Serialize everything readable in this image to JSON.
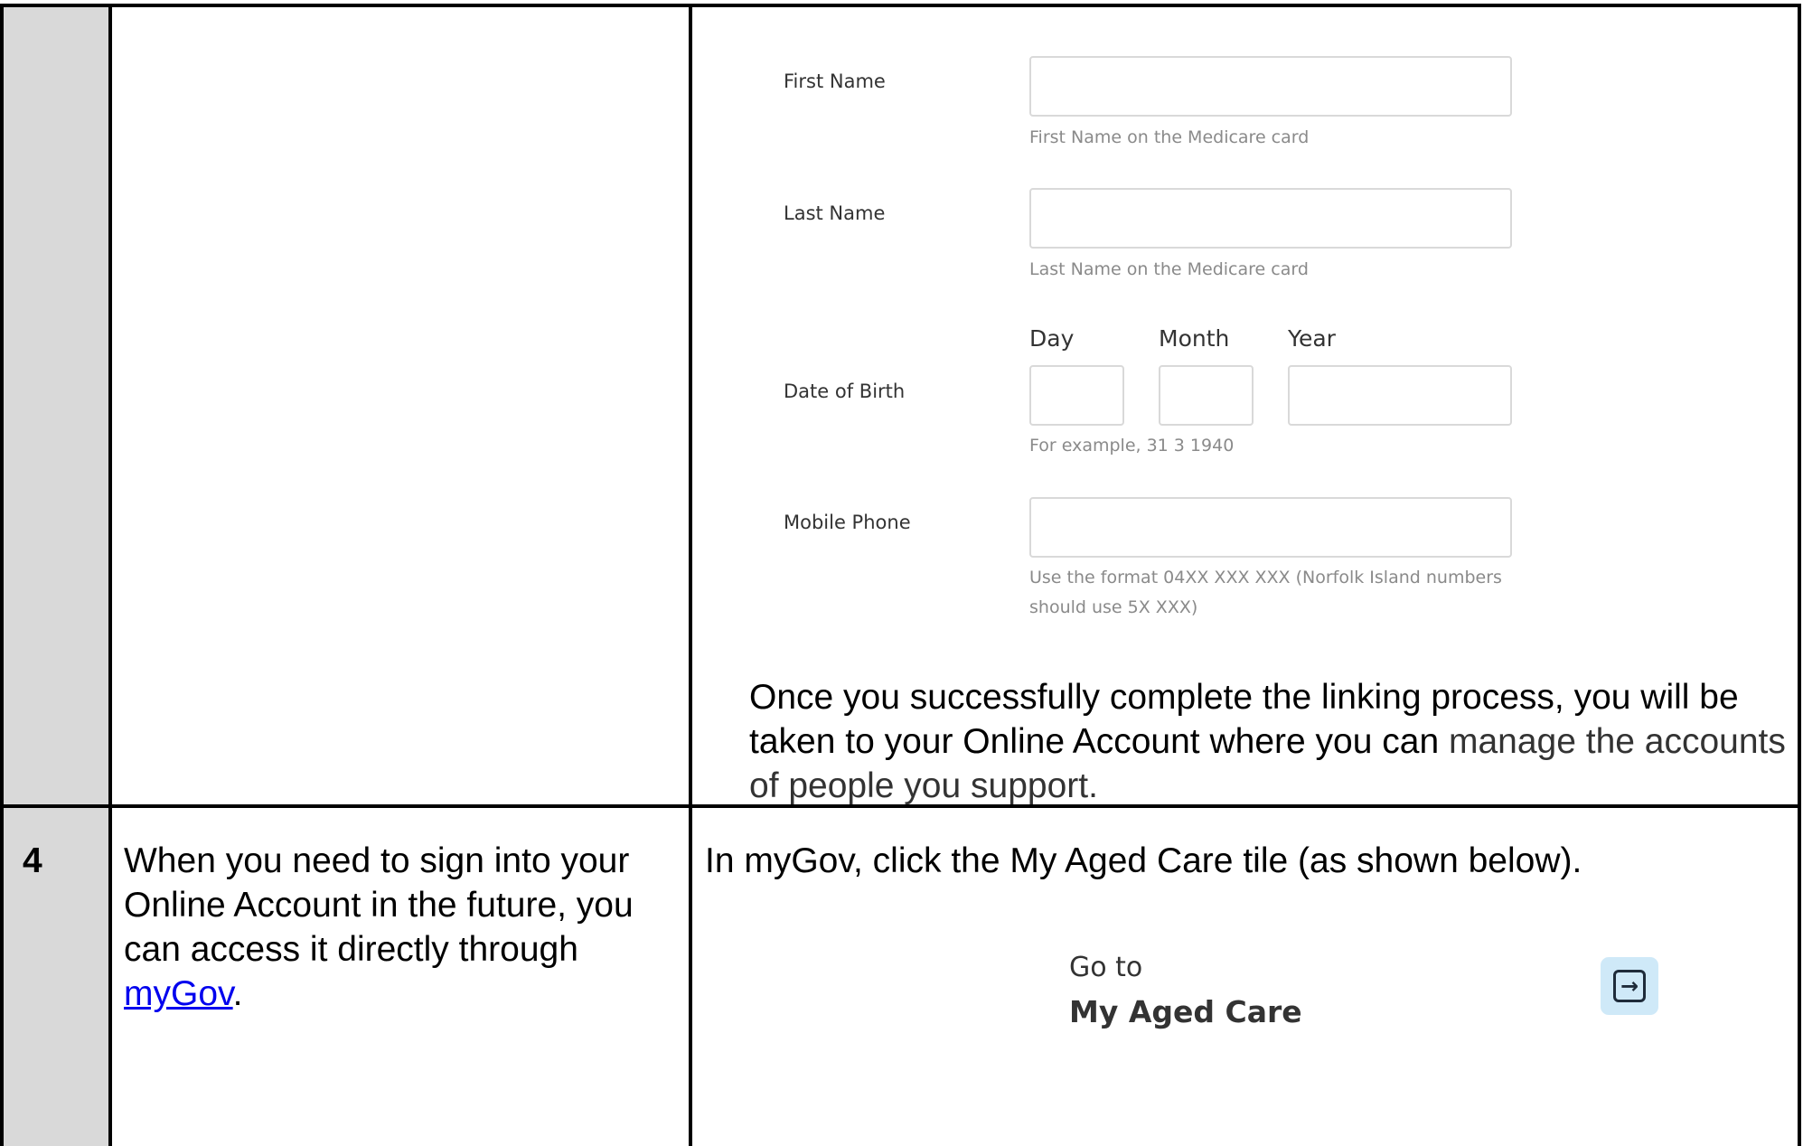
{
  "form": {
    "first_name": {
      "label": "First Name",
      "hint": "First Name on the Medicare card",
      "value": ""
    },
    "last_name": {
      "label": "Last Name",
      "hint": "Last Name on the Medicare card",
      "value": ""
    },
    "dob": {
      "label": "Date of Birth",
      "day_label": "Day",
      "month_label": "Month",
      "year_label": "Year",
      "hint": "For example, 31 3 1940",
      "day": "",
      "month": "",
      "year": ""
    },
    "mobile": {
      "label": "Mobile Phone",
      "hint": "Use the format 04XX XXX XXX (Norfolk Island numbers should use 5X XXX)",
      "value": ""
    }
  },
  "row3": {
    "after_text_a": "Once you successfully complete the linking process, you will be taken to your Online Account where you can ",
    "after_text_b": "manage the accounts of people you support."
  },
  "row4": {
    "step": "4",
    "instruction_before": "When you need to sign into your Online Account in the future, you can access it directly through ",
    "instruction_link": "myGov",
    "instruction_after": ".",
    "action_text": "In myGov, click the My Aged Care tile (as shown below).",
    "tile": {
      "pre": "Go to",
      "name": "My Aged Care",
      "icon": "arrow-right-box-icon"
    }
  },
  "colors": {
    "cell_shade": "#d9d9d9",
    "tile_button_bg": "#cfe9f8",
    "link": "#0000ee"
  }
}
